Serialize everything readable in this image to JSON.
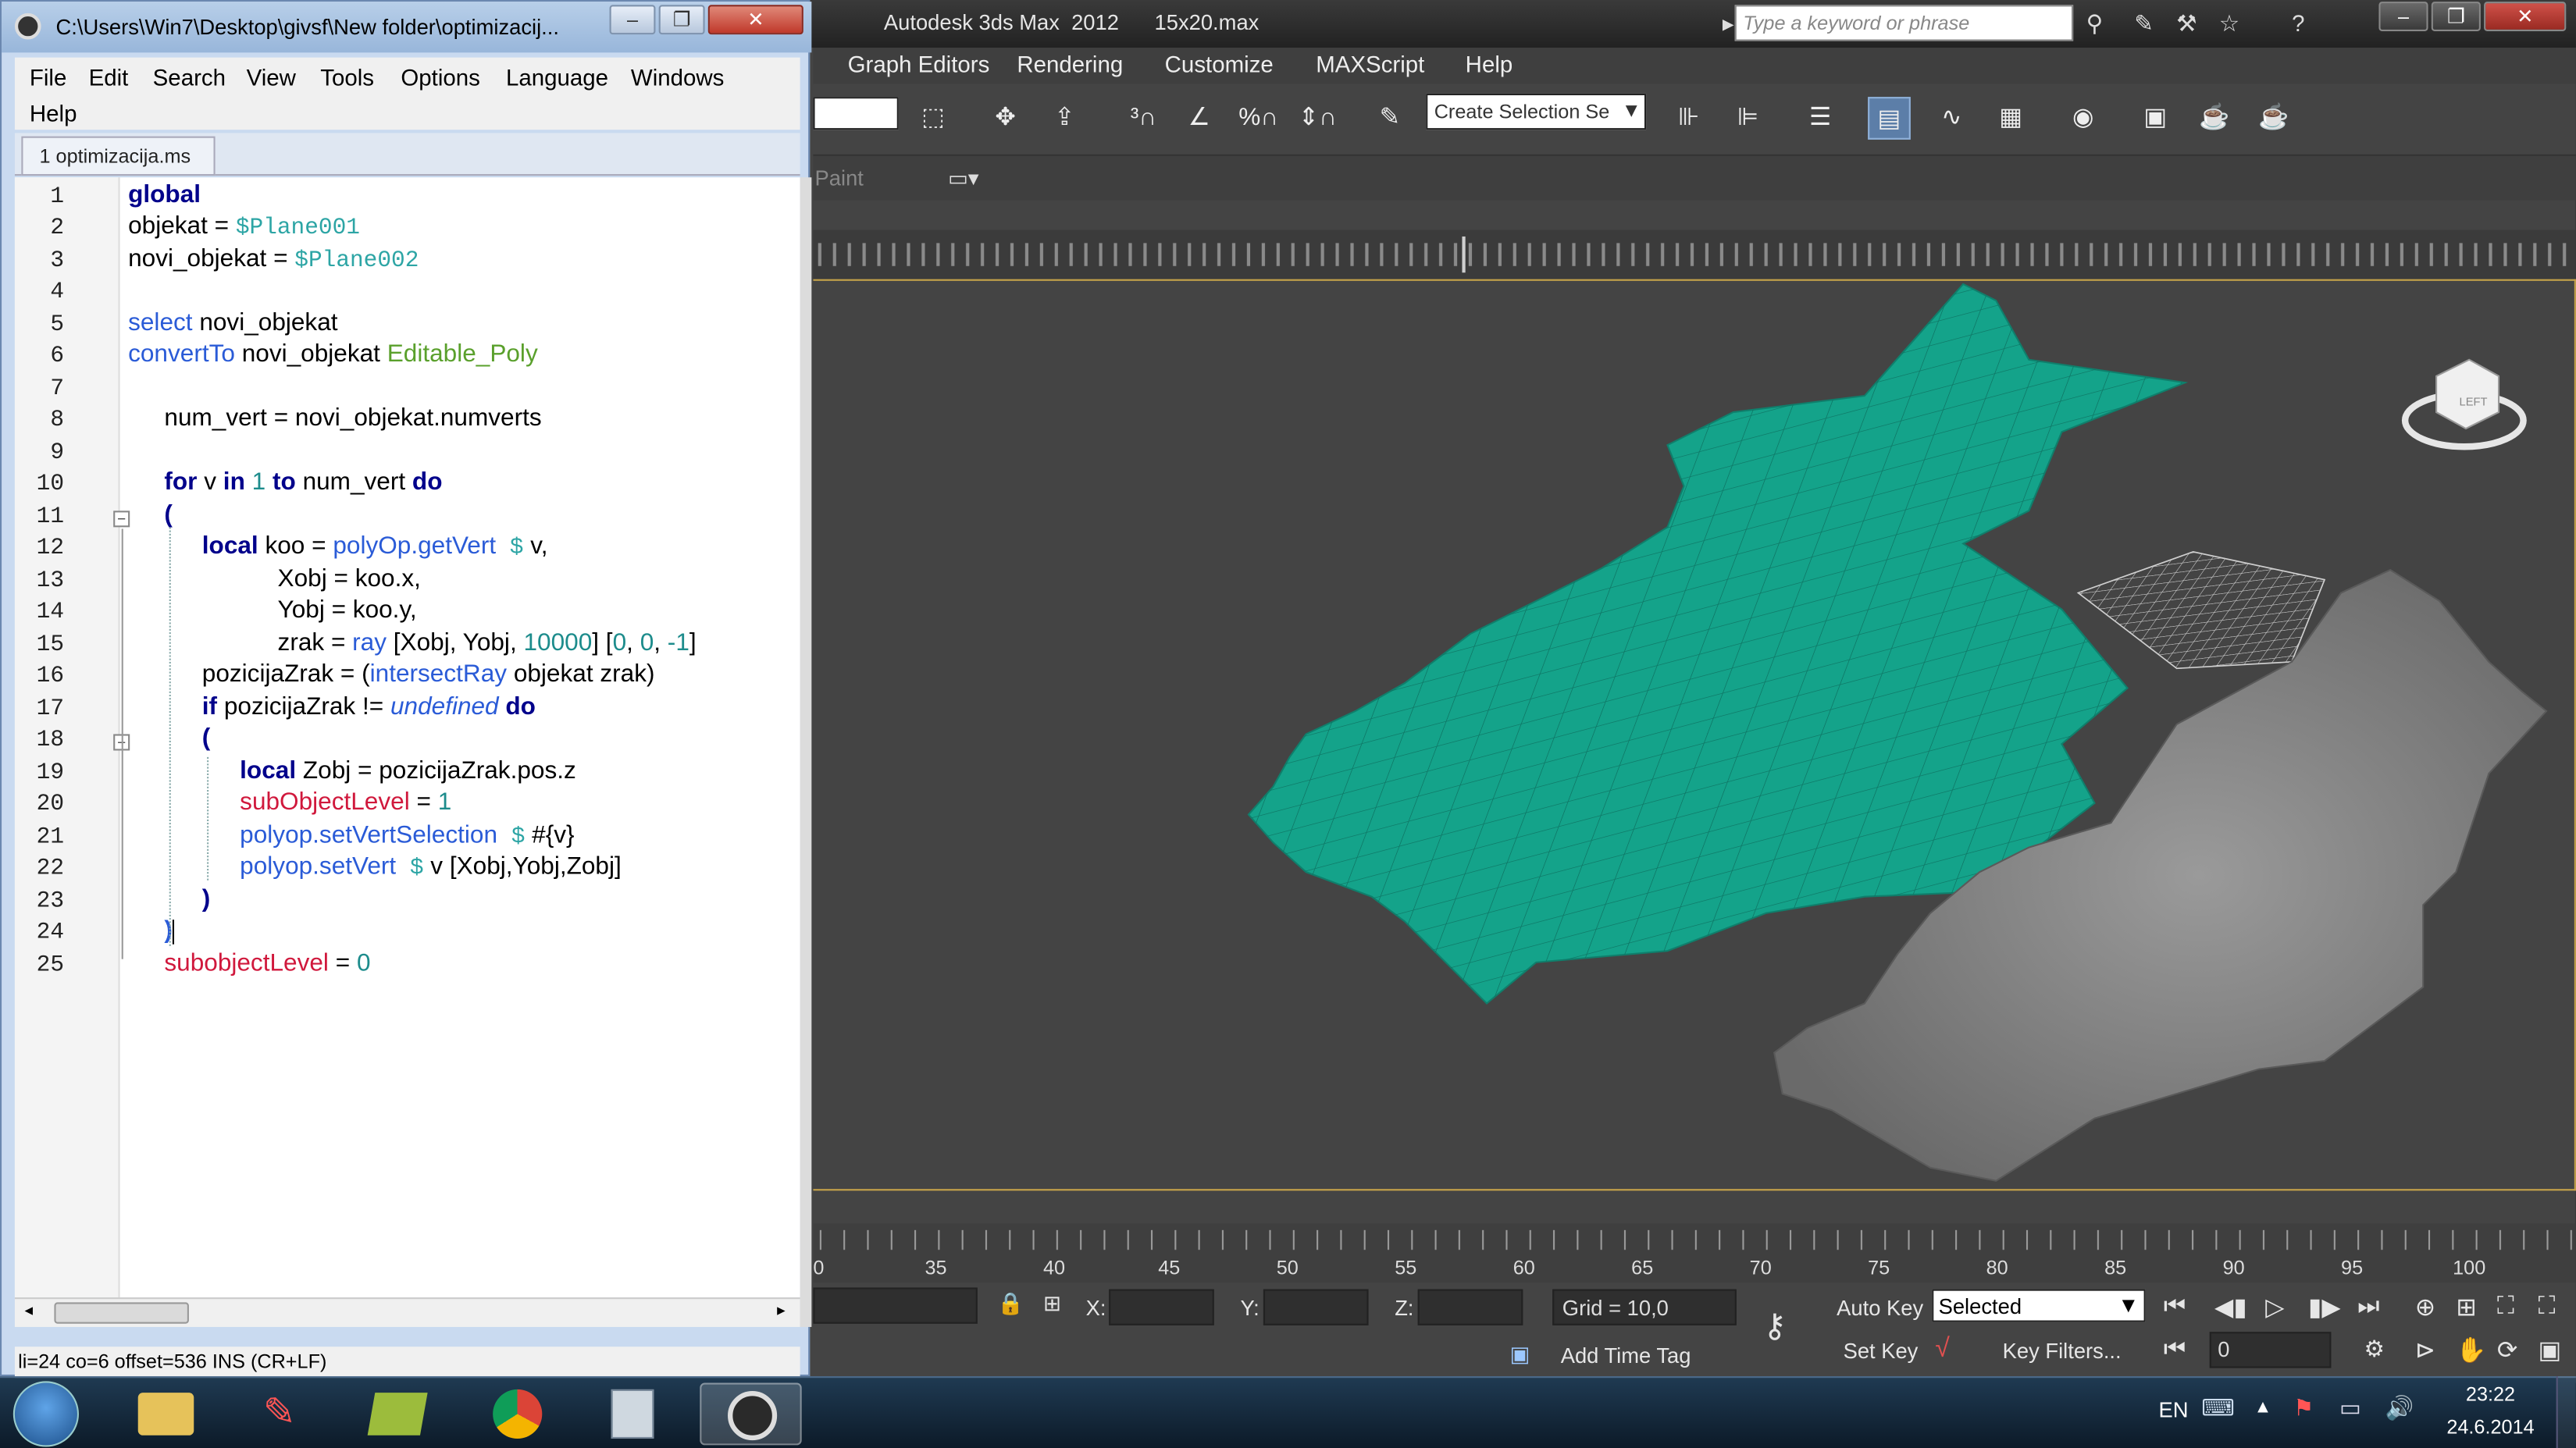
{
  "max": {
    "title": "Autodesk 3ds Max  2012      15x20.max",
    "search_placeholder": "Type a keyword or phrase",
    "menu": [
      "Graph Editors",
      "Rendering",
      "Customize",
      "MAXScript",
      "Help"
    ],
    "selection_set": "Create Selection Se",
    "ribbon_label": "Paint",
    "timeline_labels": [
      "0",
      "35",
      "40",
      "45",
      "50",
      "55",
      "60",
      "65",
      "70",
      "75",
      "80",
      "85",
      "90",
      "95",
      "100"
    ],
    "coord_x_label": "X:",
    "coord_y_label": "Y:",
    "coord_z_label": "Z:",
    "grid": "Grid = 10,0",
    "auto_key": "Auto Key",
    "set_key": "Set Key",
    "key_mode": "Selected",
    "key_filters": "Key Filters...",
    "add_time_tag": "Add Time Tag",
    "frame": "0",
    "viewcube_label": "LEFT"
  },
  "editor": {
    "title": "C:\\Users\\Win7\\Desktop\\givsf\\New folder\\optimizacij...",
    "menu": [
      "File",
      "Edit",
      "Search",
      "View",
      "Tools",
      "Options",
      "Language",
      "Windows"
    ],
    "menu_help": "Help",
    "tab": "1 optimizacija.ms",
    "status": "li=24 co=6 offset=536 INS (CR+LF)",
    "line_numbers": [
      "1",
      "2",
      "3",
      "4",
      "5",
      "6",
      "7",
      "8",
      "9",
      "10",
      "11",
      "12",
      "13",
      "14",
      "15",
      "16",
      "17",
      "18",
      "19",
      "20",
      "21",
      "22",
      "23",
      "24",
      "25"
    ],
    "code": {
      "l1_kw": "global",
      "l2_a": "objekat = ",
      "l2_b": "$Plane001",
      "l3_a": "novi_objekat = ",
      "l3_b": "$Plane002",
      "l5_a": "select",
      "l5_b": " novi_objekat",
      "l6_a": "convertTo",
      "l6_b": " novi_objekat ",
      "l6_c": "Editable_Poly",
      "l8": "num_vert = novi_objekat.numverts",
      "l10_for": "for",
      "l10_v": " v ",
      "l10_in": "in",
      "l10_one": " 1 ",
      "l10_to": "to",
      "l10_num": " num_vert ",
      "l10_do": "do",
      "l11": "(",
      "l12_local": "local",
      "l12_a": " koo = ",
      "l12_fn": "polyOp.getVert",
      "l12_s": " $",
      "l12_b": " v,",
      "l13": "Xobj = koo.x,",
      "l14": "Yobj = koo.y,",
      "l15_a": "zrak = ",
      "l15_ray": "ray",
      "l15_b": " [Xobj, Yobj, ",
      "l15_n": "10000",
      "l15_c": "] [",
      "l15_z1": "0",
      "l15_d": ", ",
      "l15_z2": "0",
      "l15_e": ", ",
      "l15_m": "-1",
      "l15_f": "]",
      "l16_a": "pozicijaZrak = (",
      "l16_fn": "intersectRay",
      "l16_b": " objekat zrak)",
      "l17_if": "if",
      "l17_a": " pozicijaZrak != ",
      "l17_und": "undefined",
      "l17_do": " do",
      "l18": "(",
      "l19_local": "local",
      "l19_a": " Zobj = pozicijaZrak.pos.z",
      "l20_a": "subObjectLevel",
      "l20_b": " = ",
      "l20_n": "1",
      "l21_fn": "polyop.setVertSelection",
      "l21_s": " $",
      "l21_b": " #{v}",
      "l22_fn": "polyop.setVert",
      "l22_s": " $",
      "l22_b": " v [Xobj,Yobj,Zobj]",
      "l23": ")",
      "l24": ")",
      "l25_a": "subobjectLevel",
      "l25_b": " = ",
      "l25_n": "0"
    }
  },
  "taskbar": {
    "lang": "EN",
    "time": "23:22",
    "date": "24.6.2014"
  }
}
